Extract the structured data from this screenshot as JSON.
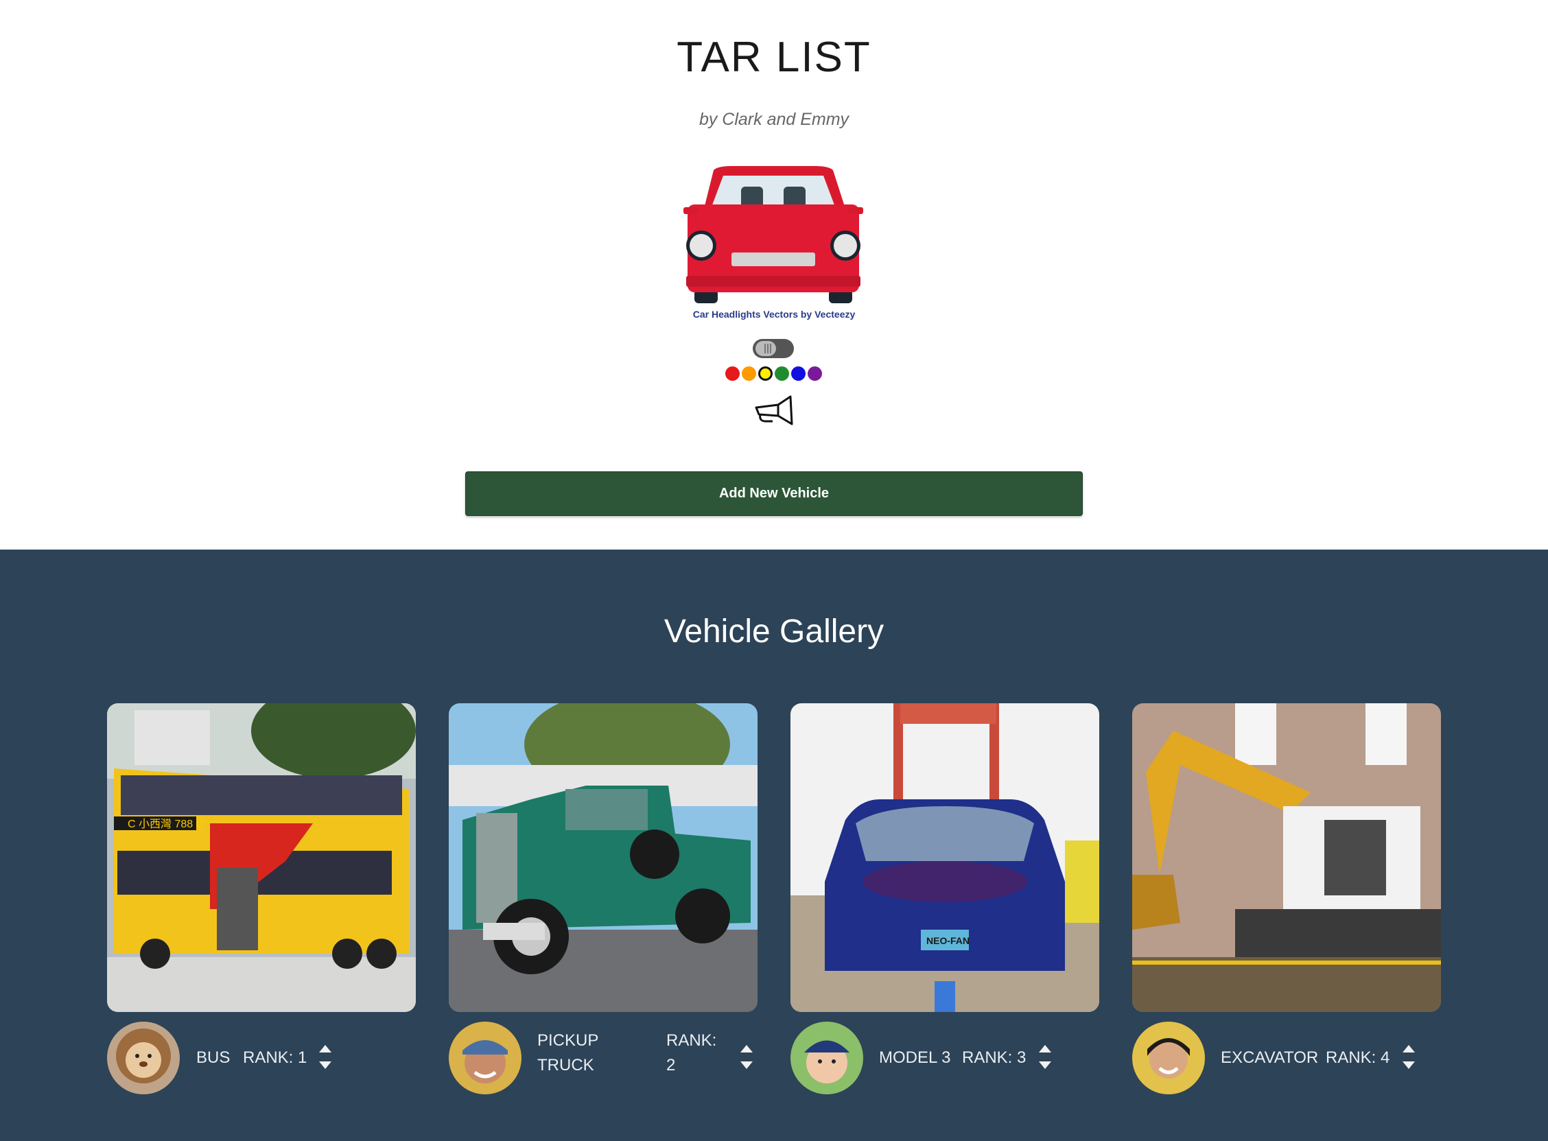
{
  "header": {
    "title": "TAR LIST",
    "subtitle": "by Clark and Emmy",
    "logo_credit": "Car Headlights Vectors by Vecteezy",
    "logo_icon": "red-car-icon",
    "theme_toggle_icon": "toggle-switch-icon",
    "horn_icon": "horn-icon",
    "colors": [
      "#e41a1c",
      "#ff9900",
      "#ffee00",
      "#1f8c2f",
      "#1010e0",
      "#7a1a9a"
    ],
    "selected_color": "#ffee00"
  },
  "actions": {
    "add_label": "Add New Vehicle"
  },
  "gallery": {
    "title": "Vehicle Gallery",
    "vehicles": [
      {
        "name": "BUS",
        "rank": "RANK: 1",
        "photo": "yellow double-decker bus",
        "avatar": "plush lion"
      },
      {
        "name": "PICKUP TRUCK",
        "rank": "RANK: 2",
        "photo": "green vintage pickup truck",
        "avatar": "smiling man"
      },
      {
        "name": "MODEL 3",
        "rank": "RANK: 3",
        "photo": "blue Tesla Model 3",
        "avatar": "child"
      },
      {
        "name": "EXCAVATOR",
        "rank": "RANK: 4",
        "photo": "yellow excavator",
        "avatar": "smiling woman"
      }
    ]
  }
}
